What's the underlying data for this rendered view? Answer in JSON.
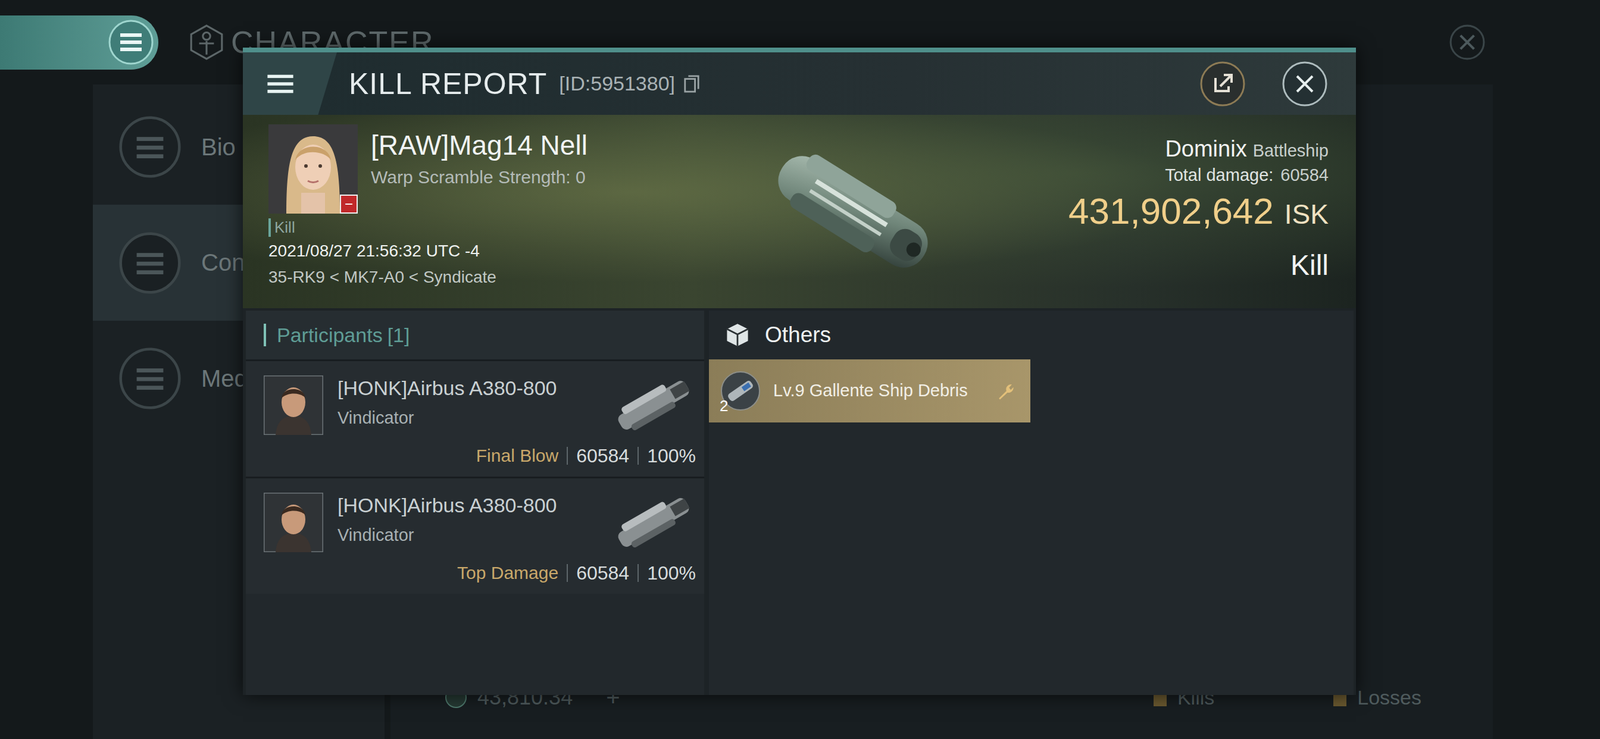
{
  "background": {
    "title": "CHARACTER",
    "tabs": [
      {
        "label": "Bio",
        "selected": false
      },
      {
        "label": "Con",
        "selected": true
      },
      {
        "label": "Med",
        "selected": false
      }
    ],
    "balance": "43,810.34",
    "plus": "+",
    "stats": [
      "Kills",
      "Losses"
    ]
  },
  "report": {
    "title": "KILL REPORT",
    "id": "[ID:5951380]",
    "victim": {
      "name": "[RAW]Mag14 Nell",
      "warp_scramble": "Warp Scramble Strength: 0",
      "badge": "−",
      "tag": "Kill",
      "time": "2021/08/27 21:56:32 UTC -4",
      "location": "35-RK9 < MK7-A0 < Syndicate"
    },
    "ship": {
      "name": "Dominix",
      "class": "Battleship",
      "damage_label": "Total damage:",
      "damage": "60584",
      "value": "431,902,642",
      "currency": "ISK",
      "result": "Kill"
    },
    "participants": {
      "label": "Participants",
      "count": "[1]",
      "rows": [
        {
          "name": "[HONK]Airbus A380-800",
          "ship": "Vindicator",
          "role": "Final Blow",
          "damage": "60584",
          "percent": "100%"
        },
        {
          "name": "[HONK]Airbus A380-800",
          "ship": "Vindicator",
          "role": "Top Damage",
          "damage": "60584",
          "percent": "100%"
        }
      ]
    },
    "others": {
      "title": "Others",
      "items": [
        {
          "name": "Lv.9 Gallente Ship Debris",
          "quantity": "2"
        }
      ]
    }
  }
}
